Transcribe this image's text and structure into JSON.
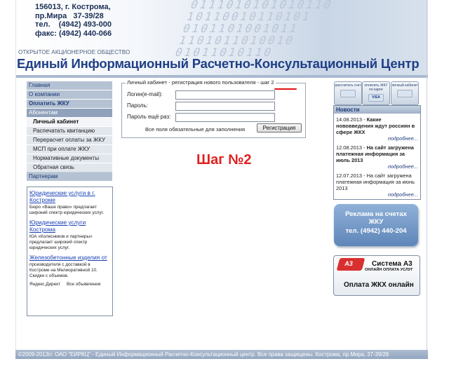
{
  "header": {
    "address_lines": [
      "156013, г. Кострома,",
      "пр.Мира   37-39/28",
      "тел.    (4942) 493-000",
      "факс: (4942) 440-066"
    ],
    "org_type": "ОТКРЫТОЕ АКЦИОНЕРНОЕ ОБЩЕСТВО",
    "title": "Единый Информационный Расчетно-Консультационный Центр",
    "digits": "0111010101010110\n10110010110101\n0101101001011\n1101011010010\n01011010110"
  },
  "nav": {
    "items": [
      {
        "label": "Главная",
        "kind": "main"
      },
      {
        "label": "О компании",
        "kind": "main"
      },
      {
        "label": "Оплатить ЖКУ",
        "kind": "main"
      },
      {
        "label": "Абонентам",
        "kind": "active"
      },
      {
        "label": "Личный кабинет",
        "kind": "sub-selected"
      },
      {
        "label": "Распечатать квитанцию",
        "kind": "sub"
      },
      {
        "label": "Перерасчет оплаты за ЖКУ",
        "kind": "sub"
      },
      {
        "label": "МСП при оплате ЖКУ",
        "kind": "sub"
      },
      {
        "label": "Нормативные документы",
        "kind": "sub"
      },
      {
        "label": "Обратная связь",
        "kind": "sub"
      },
      {
        "label": "Партнерам",
        "kind": "main"
      }
    ]
  },
  "left_ads": {
    "items": [
      {
        "link": "Юридические услуги в г. Костроме",
        "text": "Бюро «Ваше право» предлагает широкий спектр юридических услуг."
      },
      {
        "link": "Юридические услуги Кострома",
        "text": "ЮА «Колесников и партнеры» предлагает широкий спектр юридических услуг."
      },
      {
        "link": "Железобетонные изделия от",
        "text": "производителя с доставкой в Костроме на Мелиоративной 10. Скидки с объемов."
      }
    ],
    "footer_left": "Яндекс.Директ",
    "footer_right": "Все объявления"
  },
  "form": {
    "legend": "Личный кабинет - регистрация нового пользователя - шаг 2",
    "login_label": "Логин(e-mail):",
    "password_label": "Пароль:",
    "password2_label": "Пароль ещё раз:",
    "login_value": "",
    "password_value": "",
    "password2_value": "",
    "note": "Все поля обязательные для заполнения",
    "submit_label": "Регистрация"
  },
  "step_text": "Шаг №2",
  "payment_buttons": [
    {
      "label": "рассчитать счет"
    },
    {
      "label": "оплатить ЖКУ по карте",
      "subtext": "VISA"
    },
    {
      "label": "личный кабинет"
    }
  ],
  "news": {
    "title": "Новости",
    "items": [
      {
        "date": "14.08.2013",
        "text": "Какие нововведения ждут россиян в сфере ЖКХ",
        "bold": true,
        "more": "подробнее..."
      },
      {
        "date": "12.08.2013",
        "text": "На сайт загружена платежная информация за июль 2013",
        "bold": true,
        "more": "подробнее..."
      },
      {
        "date": "12.07.2013",
        "text": "На сайт загружена платежная информация за июнь 2013",
        "bold": false,
        "more": "подробнее..."
      }
    ]
  },
  "adv_banner": {
    "line1": "Реклама на счетах",
    "line2": "ЖКУ",
    "line3": "тел. (4942) 440-204"
  },
  "a3_banner": {
    "logo": "A3",
    "title": "Система А3",
    "subtitle": "ОНЛАЙН ОПЛАТА УСЛУГ",
    "cta": "Оплата ЖКХ онлайн"
  },
  "footer": {
    "text": "©2009-2013гг. ОАО \"ЕИРКЦ\" - Единый Информационный Расчетно-Консультационный центр. Все права защищены. Кострома, пр.Мира, 37-39/28"
  },
  "colors": {
    "accent": "#1f3f85",
    "step_red": "#e02020",
    "nav_active": "#8fa1bb"
  }
}
